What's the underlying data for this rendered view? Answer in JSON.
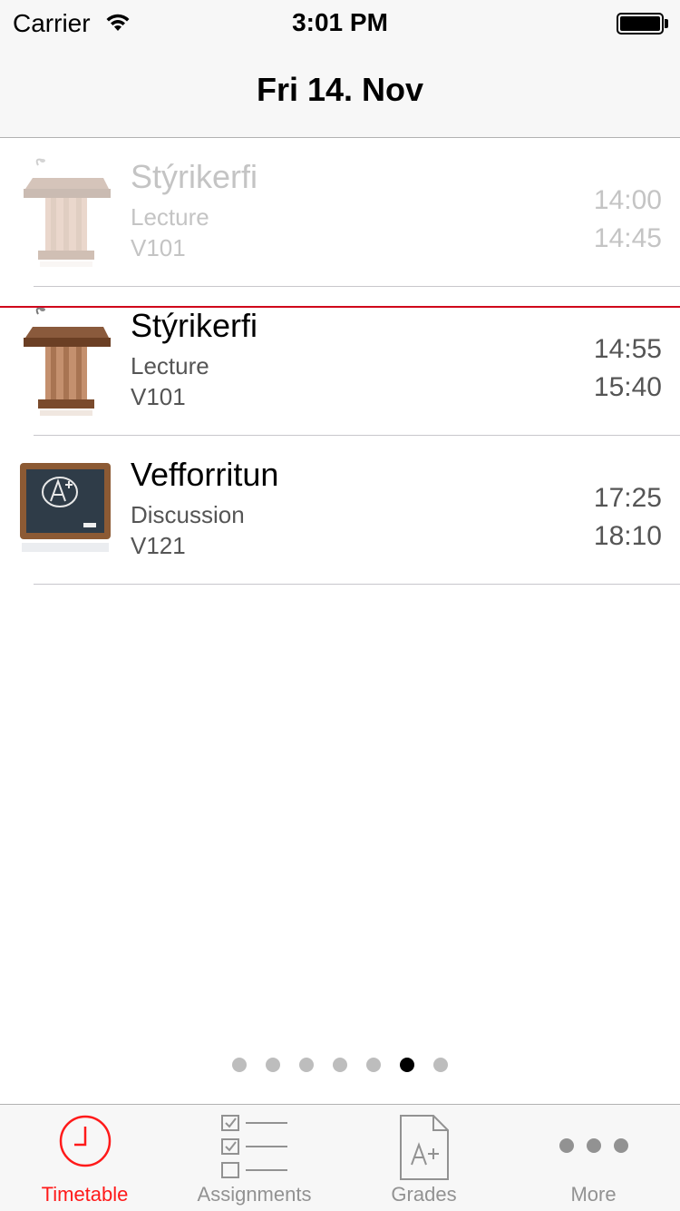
{
  "status_bar": {
    "carrier": "Carrier",
    "time": "3:01 PM"
  },
  "nav": {
    "title": "Fri 14. Nov"
  },
  "rows": [
    {
      "course": "Stýrikerfi",
      "type": "Lecture",
      "room": "V101",
      "start": "14:00",
      "end": "14:45",
      "state": "past",
      "icon": "podium-icon"
    },
    {
      "course": "Stýrikerfi",
      "type": "Lecture",
      "room": "V101",
      "start": "14:55",
      "end": "15:40",
      "state": "upcoming",
      "icon": "podium-icon"
    },
    {
      "course": "Vefforritun",
      "type": "Discussion",
      "room": "V121",
      "start": "17:25",
      "end": "18:10",
      "state": "upcoming",
      "icon": "chalkboard-icon"
    }
  ],
  "page_indicator": {
    "total": 7,
    "current": 6
  },
  "tabs": [
    {
      "label": "Timetable",
      "icon": "clock-icon",
      "selected": true
    },
    {
      "label": "Assignments",
      "icon": "checklist-icon",
      "selected": false
    },
    {
      "label": "Grades",
      "icon": "grade-document-icon",
      "selected": false
    },
    {
      "label": "More",
      "icon": "more-dots-icon",
      "selected": false
    }
  ],
  "colors": {
    "accent": "#ff1a1a",
    "now_line": "#d0021b",
    "tab_inactive": "#929292",
    "bar_bg": "#f7f7f7"
  }
}
